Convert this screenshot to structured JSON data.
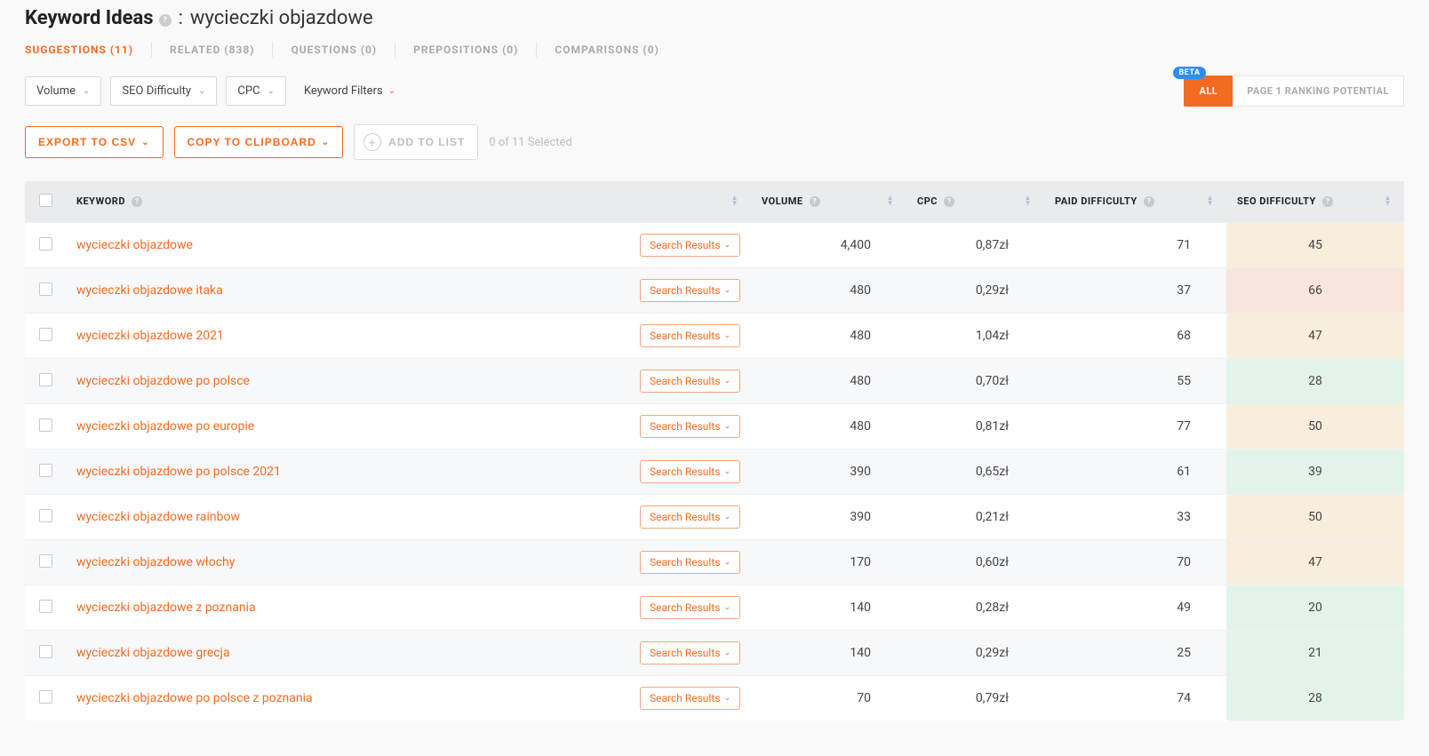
{
  "header": {
    "title": "Keyword Ideas",
    "query": "wycieczki objazdowe"
  },
  "tabs": [
    {
      "label": "SUGGESTIONS (11)",
      "active": true
    },
    {
      "label": "RELATED (838)"
    },
    {
      "label": "QUESTIONS (0)"
    },
    {
      "label": "PREPOSITIONS (0)"
    },
    {
      "label": "COMPARISONS (0)"
    }
  ],
  "filters": {
    "volume": "Volume",
    "seo_diff": "SEO Difficulty",
    "cpc": "CPC",
    "keyword_filters": "Keyword Filters"
  },
  "beta_label": "BETA",
  "toggle": {
    "all": "ALL",
    "ranking_potential": "PAGE 1 RANKING POTENTIAL"
  },
  "actions": {
    "export_csv": "EXPORT TO CSV",
    "copy_clipboard": "COPY TO CLIPBOARD",
    "add_to_list": "ADD TO LIST",
    "selected": "0 of 11 Selected"
  },
  "columns": {
    "keyword": "KEYWORD",
    "volume": "VOLUME",
    "cpc": "CPC",
    "paid": "PAID DIFFICULTY",
    "seo": "SEO DIFFICULTY"
  },
  "search_results_btn": "Search Results",
  "rows": [
    {
      "kw": "wycieczki objazdowe",
      "vol": "4,400",
      "cpc": "0,87zł",
      "paid": "71",
      "seo": "45",
      "seo_tone": "amber"
    },
    {
      "kw": "wycieczki objazdowe itaka",
      "vol": "480",
      "cpc": "0,29zł",
      "paid": "37",
      "seo": "66",
      "seo_tone": "peach"
    },
    {
      "kw": "wycieczki objazdowe 2021",
      "vol": "480",
      "cpc": "1,04zł",
      "paid": "68",
      "seo": "47",
      "seo_tone": "amber"
    },
    {
      "kw": "wycieczki objazdowe po polsce",
      "vol": "480",
      "cpc": "0,70zł",
      "paid": "55",
      "seo": "28",
      "seo_tone": "green"
    },
    {
      "kw": "wycieczki objazdowe po europie",
      "vol": "480",
      "cpc": "0,81zł",
      "paid": "77",
      "seo": "50",
      "seo_tone": "amber"
    },
    {
      "kw": "wycieczki objazdowe po polsce 2021",
      "vol": "390",
      "cpc": "0,65zł",
      "paid": "61",
      "seo": "39",
      "seo_tone": "green"
    },
    {
      "kw": "wycieczki objazdowe rainbow",
      "vol": "390",
      "cpc": "0,21zł",
      "paid": "33",
      "seo": "50",
      "seo_tone": "amber"
    },
    {
      "kw": "wycieczki objazdowe włochy",
      "vol": "170",
      "cpc": "0,60zł",
      "paid": "70",
      "seo": "47",
      "seo_tone": "amber"
    },
    {
      "kw": "wycieczki objazdowe z poznania",
      "vol": "140",
      "cpc": "0,28zł",
      "paid": "49",
      "seo": "20",
      "seo_tone": "green"
    },
    {
      "kw": "wycieczki objazdowe grecja",
      "vol": "140",
      "cpc": "0,29zł",
      "paid": "25",
      "seo": "21",
      "seo_tone": "green"
    },
    {
      "kw": "wycieczki objazdowe po polsce z poznania",
      "vol": "70",
      "cpc": "0,79zł",
      "paid": "74",
      "seo": "28",
      "seo_tone": "green"
    }
  ]
}
